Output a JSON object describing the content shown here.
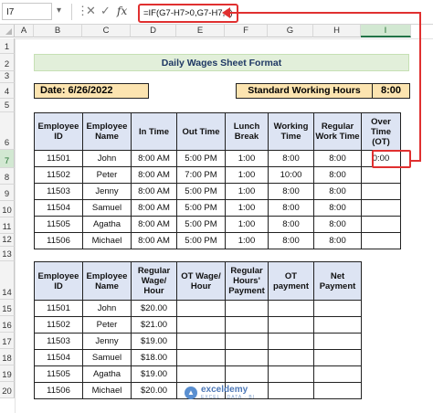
{
  "formula_bar": {
    "name_box": "I7",
    "name_arrow": "▾",
    "menu_icon": "⋮",
    "cancel_icon": "✕",
    "enter_icon": "✓",
    "fx": "fx",
    "formula": "=IF(G7-H7>0,G7-H7,0)"
  },
  "columns": [
    "A",
    "B",
    "C",
    "D",
    "E",
    "F",
    "G",
    "H",
    "I"
  ],
  "selected_column": "I",
  "rows": [
    "1",
    "2",
    "3",
    "4",
    "5",
    "6",
    "7",
    "8",
    "9",
    "10",
    "11",
    "12",
    "13",
    "14",
    "15",
    "16",
    "17",
    "18",
    "19",
    "20"
  ],
  "selected_row": "7",
  "sheet": {
    "title": "Daily Wages Sheet Format",
    "date_label": "Date: 6/26/2022",
    "standard_hours_label": "Standard Working Hours",
    "standard_hours_value": "8:00"
  },
  "table1": {
    "headers": [
      "Employee ID",
      "Employee Name",
      "In Time",
      "Out Time",
      "Lunch Break",
      "Working Time",
      "Regular Work Time",
      "Over Time (OT)"
    ],
    "rows": [
      [
        "11501",
        "John",
        "8:00 AM",
        "5:00 PM",
        "1:00",
        "8:00",
        "8:00",
        "0:00"
      ],
      [
        "11502",
        "Peter",
        "8:00 AM",
        "7:00 PM",
        "1:00",
        "10:00",
        "8:00",
        ""
      ],
      [
        "11503",
        "Jenny",
        "8:00 AM",
        "5:00 PM",
        "1:00",
        "8:00",
        "8:00",
        ""
      ],
      [
        "11504",
        "Samuel",
        "8:00 AM",
        "5:00 PM",
        "1:00",
        "8:00",
        "8:00",
        ""
      ],
      [
        "11505",
        "Agatha",
        "8:00 AM",
        "5:00 PM",
        "1:00",
        "8:00",
        "8:00",
        ""
      ],
      [
        "11506",
        "Michael",
        "8:00 AM",
        "5:00 PM",
        "1:00",
        "8:00",
        "8:00",
        ""
      ]
    ]
  },
  "table2": {
    "headers": [
      "Employee ID",
      "Employee Name",
      "Regular Wage/ Hour",
      "OT Wage/ Hour",
      "Regular Hours' Payment",
      "OT payment",
      "Net Payment"
    ],
    "rows": [
      [
        "11501",
        "John",
        "$20.00",
        "",
        "",
        "",
        ""
      ],
      [
        "11502",
        "Peter",
        "$21.00",
        "",
        "",
        "",
        ""
      ],
      [
        "11503",
        "Jenny",
        "$19.00",
        "",
        "",
        "",
        ""
      ],
      [
        "11504",
        "Samuel",
        "$18.00",
        "",
        "",
        "",
        ""
      ],
      [
        "11505",
        "Agatha",
        "$19.00",
        "",
        "",
        "",
        ""
      ],
      [
        "11506",
        "Michael",
        "$20.00",
        "",
        "",
        "",
        ""
      ]
    ]
  },
  "watermark": {
    "brand": "exceldemy",
    "tagline": "EXCEL · DATA · BI"
  },
  "colors": {
    "highlight_red": "#e03030",
    "title_fill": "#e2efda",
    "date_fill": "#fce4b0",
    "header_fill": "#dde4f3",
    "selected_header": "#d2e8d2"
  }
}
